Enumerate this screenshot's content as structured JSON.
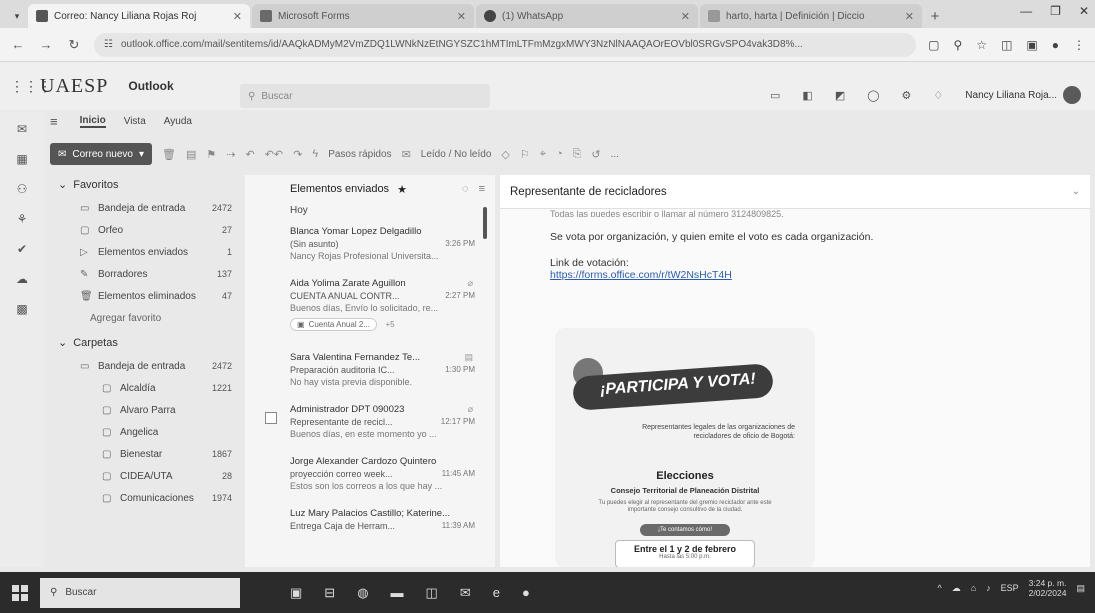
{
  "browser": {
    "tabs": [
      {
        "title": "Correo: Nancy Liliana Rojas Roj",
        "active": true
      },
      {
        "title": "Microsoft Forms",
        "active": false
      },
      {
        "title": "(1) WhatsApp",
        "active": false
      },
      {
        "title": "harto, harta | Definición | Diccio",
        "active": false
      }
    ],
    "url": "outlook.office.com/mail/sentitems/id/AAQkADMyM2VmZDQ1LWNkNzEtNGYSZC1hMTImLTFmMzgxMWY3NzNlNAAQAOrEOVbl0SRGvSPO4vak3D8%..."
  },
  "outlook": {
    "brand": "UAESP",
    "app_name": "Outlook",
    "search_placeholder": "Buscar",
    "user_name": "Nancy Liliana Roja..."
  },
  "ribbon": {
    "tabs": [
      "Inicio",
      "Vista",
      "Ayuda"
    ],
    "new_mail": "Correo nuevo",
    "quick_steps": "Pasos rápidos",
    "read_unread": "Leído / No leído",
    "more": "..."
  },
  "folders": {
    "favorites_label": "Favoritos",
    "favorites": [
      {
        "name": "Bandeja de entrada",
        "count": "2472"
      },
      {
        "name": "Orfeo",
        "count": "27"
      },
      {
        "name": "Elementos enviados",
        "count": "1"
      },
      {
        "name": "Borradores",
        "count": "137"
      },
      {
        "name": "Elementos eliminados",
        "count": "47"
      }
    ],
    "add_favorite": "Agregar favorito",
    "folders_label": "Carpetas",
    "inbox": {
      "name": "Bandeja de entrada",
      "count": "2472"
    },
    "subfolders": [
      {
        "name": "Alcaldía",
        "count": "1221"
      },
      {
        "name": "Alvaro Parra",
        "count": ""
      },
      {
        "name": "Angelica",
        "count": ""
      },
      {
        "name": "Bienestar",
        "count": "1867"
      },
      {
        "name": "CIDEA/UTA",
        "count": "28"
      },
      {
        "name": "Comunicaciones",
        "count": "1974"
      }
    ]
  },
  "message_list": {
    "title": "Elementos enviados",
    "group": "Hoy",
    "messages": [
      {
        "sender": "Blanca Yomar Lopez Delgadillo",
        "subject": "(Sin asunto)",
        "preview": "Nancy Rojas Profesional Universita...",
        "time": "3:26 PM"
      },
      {
        "sender": "Aida Yolima Zarate Aguillon",
        "subject": "CUENTA ANUAL CONTR...",
        "preview": "Buenos días, Envío lo solicitado, re...",
        "time": "2:27 PM",
        "attachment": "Cuenta Anual 2...",
        "more": "+5"
      },
      {
        "sender": "Sara Valentina Fernandez Te...",
        "subject": "Preparación auditoria IC...",
        "preview": "No hay vista previa disponible.",
        "time": "1:30 PM"
      },
      {
        "sender": "Administrador DPT 090023",
        "subject": "Representante de recicl...",
        "preview": "Buenos días, en este momento yo ...",
        "time": "12:17 PM"
      },
      {
        "sender": "Jorge Alexander Cardozo Quintero",
        "subject": "proyección correo week...",
        "preview": "Estos son los correos a los que hay ...",
        "time": "11:45 AM"
      },
      {
        "sender": "Luz Mary Palacios Castillo; Katerine...",
        "subject": "Entrega Caja de Herram...",
        "preview": "",
        "time": "11:39 AM"
      }
    ]
  },
  "reading": {
    "subject": "Representante  de recicladores",
    "cut_line": "Todas las puedes escribir o llamar al número 3124809825.",
    "vote_text": "Se  vota por organización, y quien emite el voto es cada organización.",
    "link_label": "Link de votación:",
    "link_url": "https://forms.office.com/r/tW2NsHcT4H",
    "poster": {
      "headline": "¡PARTICIPA Y VOTA!",
      "subtitle": "Representantes legales de las organizaciones de recicladores de oficio de Bogotá:",
      "elections": "Elecciones",
      "council": "Consejo Territorial de Planeación Distrital",
      "small": "Tu puedes elegir al representante del gremio reciclador ante este importante consejo consultivo de la ciudad.",
      "pill": "¡Te contamos cómo!",
      "date": "Entre el 1 y 2 de febrero",
      "date_small": "Hasta las 5:00 p.m."
    }
  },
  "taskbar": {
    "search": "Buscar",
    "lang": "ESP",
    "time": "3:24 p. m.",
    "date": "2/02/2024"
  }
}
